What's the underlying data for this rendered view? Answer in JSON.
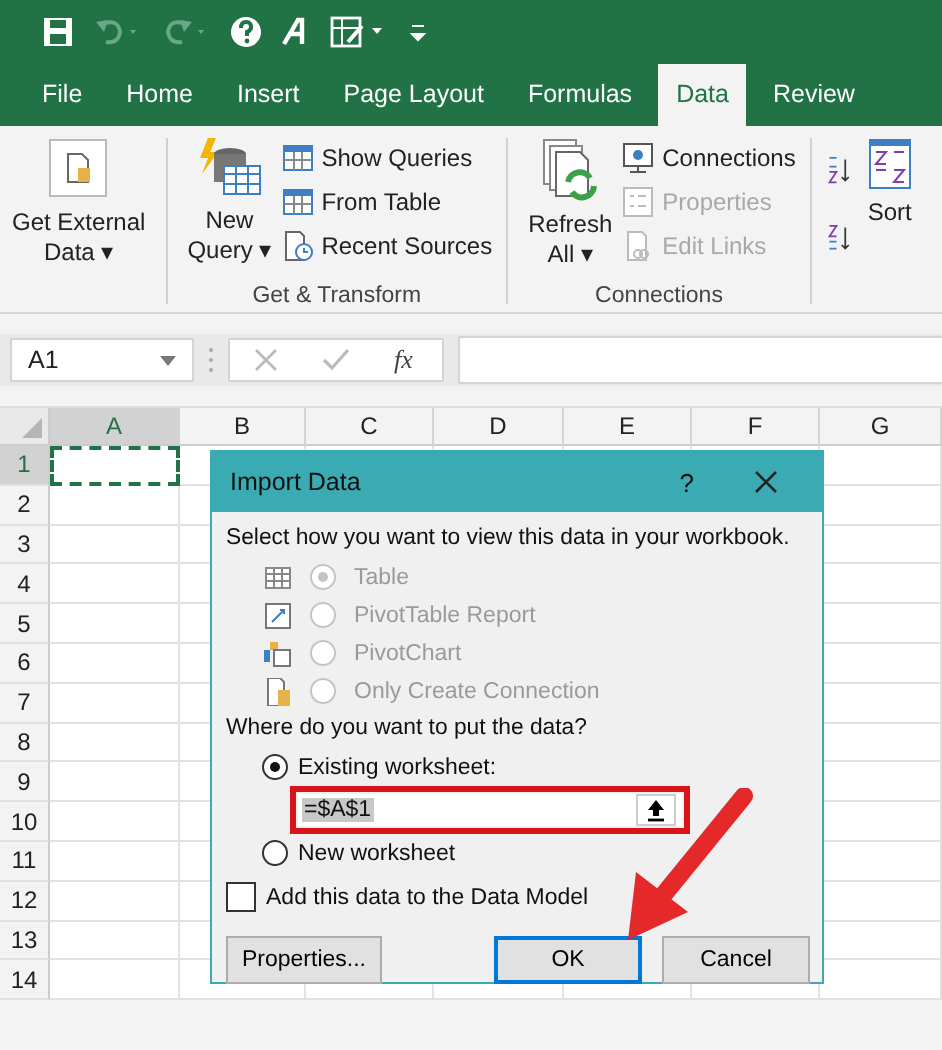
{
  "tabs": [
    {
      "label": "File",
      "selected": false
    },
    {
      "label": "Home",
      "selected": false
    },
    {
      "label": "Insert",
      "selected": false
    },
    {
      "label": "Page Layout",
      "selected": false
    },
    {
      "label": "Formulas",
      "selected": false
    },
    {
      "label": "Data",
      "selected": true
    },
    {
      "label": "Review",
      "selected": false
    }
  ],
  "ribbon": {
    "get_external_data": {
      "lines": [
        "Get External",
        "Data ▾"
      ]
    },
    "get_transform": {
      "title": "Get & Transform",
      "new_query": {
        "lines": [
          "New",
          "Query ▾"
        ]
      },
      "commands": [
        {
          "label": "Show Queries",
          "disabled": false
        },
        {
          "label": "From Table",
          "disabled": false
        },
        {
          "label": "Recent Sources",
          "disabled": false
        }
      ]
    },
    "connections": {
      "title": "Connections",
      "refresh": {
        "lines": [
          "Refresh",
          "All ▾"
        ]
      },
      "commands": [
        {
          "label": "Connections",
          "disabled": false
        },
        {
          "label": "Properties",
          "disabled": true
        },
        {
          "label": "Edit Links",
          "disabled": true
        }
      ]
    },
    "sort": {
      "label": "Sort"
    }
  },
  "formula_bar": {
    "name_box": "A1",
    "fx": "fx"
  },
  "sheet": {
    "columns": [
      {
        "label": "A",
        "selected": true
      },
      {
        "label": "B",
        "selected": false
      },
      {
        "label": "C",
        "selected": false
      },
      {
        "label": "D",
        "selected": false
      },
      {
        "label": "E",
        "selected": false
      },
      {
        "label": "F",
        "selected": false
      },
      {
        "label": "G",
        "selected": false
      }
    ],
    "rows": [
      {
        "label": "1",
        "selected": true
      },
      {
        "label": "2",
        "selected": false
      },
      {
        "label": "3",
        "selected": false
      },
      {
        "label": "4",
        "selected": false
      },
      {
        "label": "5",
        "selected": false
      },
      {
        "label": "6",
        "selected": false
      },
      {
        "label": "7",
        "selected": false
      },
      {
        "label": "8",
        "selected": false
      },
      {
        "label": "9",
        "selected": false
      },
      {
        "label": "10",
        "selected": false
      },
      {
        "label": "11",
        "selected": false
      },
      {
        "label": "12",
        "selected": false
      },
      {
        "label": "13",
        "selected": false
      },
      {
        "label": "14",
        "selected": false
      }
    ]
  },
  "dialog": {
    "title": "Import Data",
    "help": "?",
    "prompt": "Select how you want to view this data in your workbook.",
    "view_options": [
      {
        "label": "Table",
        "selected": true,
        "disabled": true
      },
      {
        "label": "PivotTable Report",
        "selected": false,
        "disabled": true
      },
      {
        "label": "PivotChart",
        "selected": false,
        "disabled": true
      },
      {
        "label": "Only Create Connection",
        "selected": false,
        "disabled": true
      }
    ],
    "location_prompt": "Where do you want to put the data?",
    "existing": {
      "label": "Existing worksheet:",
      "selected": true,
      "value": "=$A$1"
    },
    "new": {
      "label": "New worksheet",
      "selected": false
    },
    "data_model": {
      "label": "Add this data to the Data Model",
      "checked": false
    },
    "buttons": [
      {
        "label": "Properties...",
        "default": false
      },
      {
        "label": "OK",
        "default": true
      },
      {
        "label": "Cancel",
        "default": false
      }
    ]
  }
}
